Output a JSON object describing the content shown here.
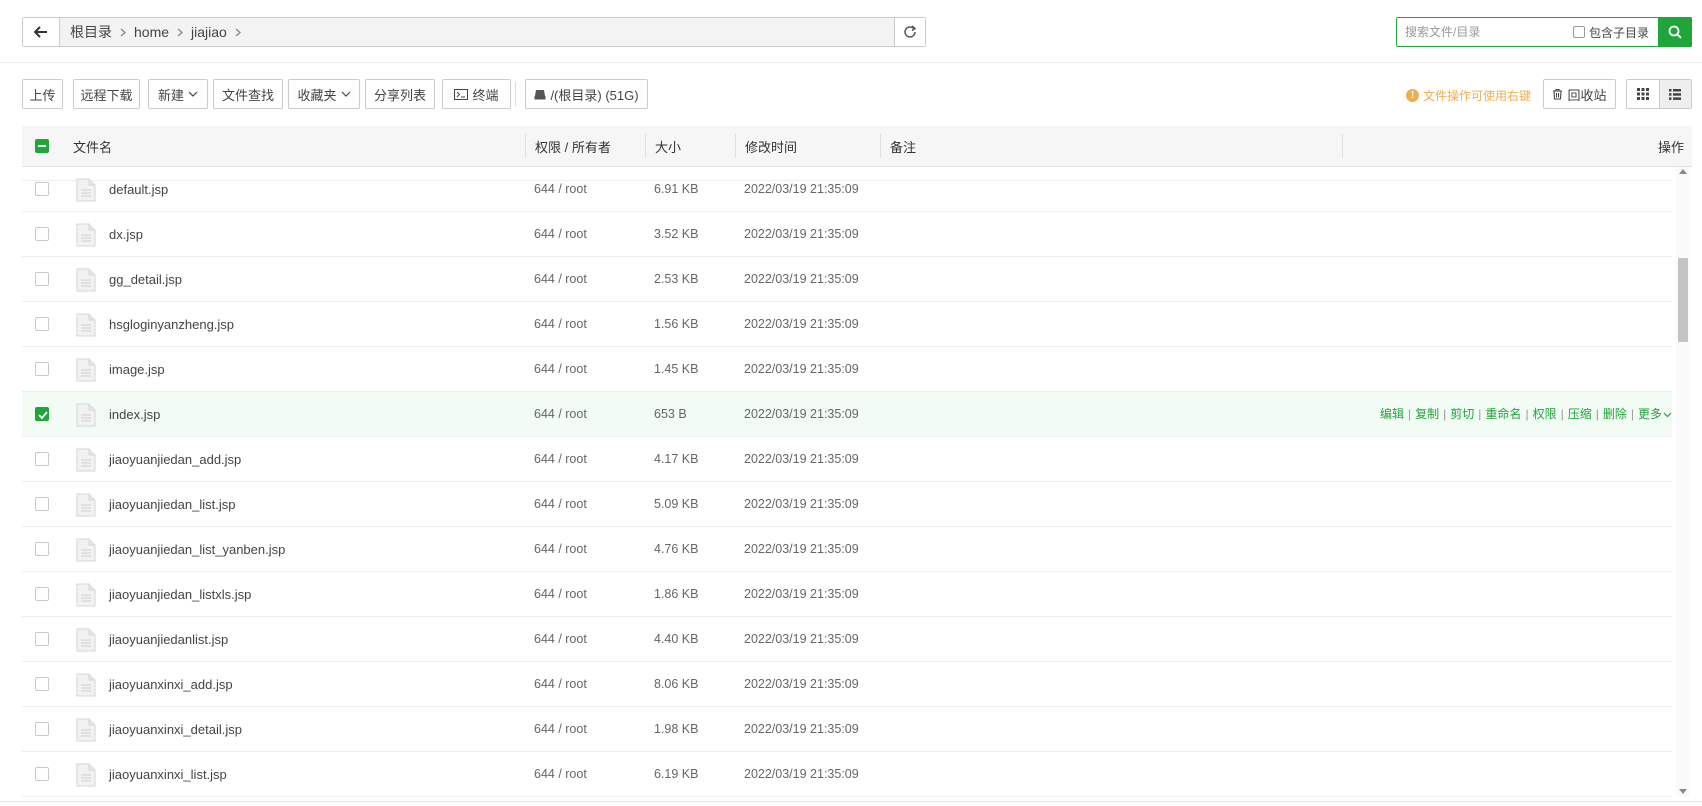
{
  "path_bar": {
    "crumbs": [
      "根目录",
      "home",
      "jiajiao"
    ]
  },
  "search": {
    "placeholder": "搜索文件/目录",
    "subdir_label": "包含子目录"
  },
  "toolbar": {
    "upload": "上传",
    "remote_download": "远程下载",
    "new": "新建",
    "file_search": "文件查找",
    "favorites": "收藏夹",
    "share_list": "分享列表",
    "terminal": "终端",
    "disk": "/(根目录) (51G)",
    "tip": "文件操作可使用右键",
    "recycle": "回收站"
  },
  "table": {
    "headers": {
      "name": "文件名",
      "perm": "权限 / 所有者",
      "size": "大小",
      "mtime": "修改时间",
      "note": "备注",
      "ops": "操作"
    },
    "rows": [
      {
        "name": "default.jsp",
        "perm": "644 / root",
        "size": "6.91 KB",
        "mtime": "2022/03/19 21:35:09"
      },
      {
        "name": "dx.jsp",
        "perm": "644 / root",
        "size": "3.52 KB",
        "mtime": "2022/03/19 21:35:09"
      },
      {
        "name": "gg_detail.jsp",
        "perm": "644 / root",
        "size": "2.53 KB",
        "mtime": "2022/03/19 21:35:09"
      },
      {
        "name": "hsgloginyanzheng.jsp",
        "perm": "644 / root",
        "size": "1.56 KB",
        "mtime": "2022/03/19 21:35:09"
      },
      {
        "name": "image.jsp",
        "perm": "644 / root",
        "size": "1.45 KB",
        "mtime": "2022/03/19 21:35:09"
      },
      {
        "name": "index.jsp",
        "perm": "644 / root",
        "size": "653 B",
        "mtime": "2022/03/19 21:35:09",
        "selected": true
      },
      {
        "name": "jiaoyuanjiedan_add.jsp",
        "perm": "644 / root",
        "size": "4.17 KB",
        "mtime": "2022/03/19 21:35:09"
      },
      {
        "name": "jiaoyuanjiedan_list.jsp",
        "perm": "644 / root",
        "size": "5.09 KB",
        "mtime": "2022/03/19 21:35:09"
      },
      {
        "name": "jiaoyuanjiedan_list_yanben.jsp",
        "perm": "644 / root",
        "size": "4.76 KB",
        "mtime": "2022/03/19 21:35:09"
      },
      {
        "name": "jiaoyuanjiedan_listxls.jsp",
        "perm": "644 / root",
        "size": "1.86 KB",
        "mtime": "2022/03/19 21:35:09"
      },
      {
        "name": "jiaoyuanjiedanlist.jsp",
        "perm": "644 / root",
        "size": "4.40 KB",
        "mtime": "2022/03/19 21:35:09"
      },
      {
        "name": "jiaoyuanxinxi_add.jsp",
        "perm": "644 / root",
        "size": "8.06 KB",
        "mtime": "2022/03/19 21:35:09"
      },
      {
        "name": "jiaoyuanxinxi_detail.jsp",
        "perm": "644 / root",
        "size": "1.98 KB",
        "mtime": "2022/03/19 21:35:09"
      },
      {
        "name": "jiaoyuanxinxi_list.jsp",
        "perm": "644 / root",
        "size": "6.19 KB",
        "mtime": "2022/03/19 21:35:09"
      }
    ],
    "row_ops": [
      "编辑",
      "复制",
      "剪切",
      "重命名",
      "权限",
      "压缩",
      "删除",
      "更多"
    ]
  },
  "colors": {
    "accent": "#20a53a",
    "tip": "#f0ad4e",
    "selected_row_bg": "#f2fbf4"
  }
}
